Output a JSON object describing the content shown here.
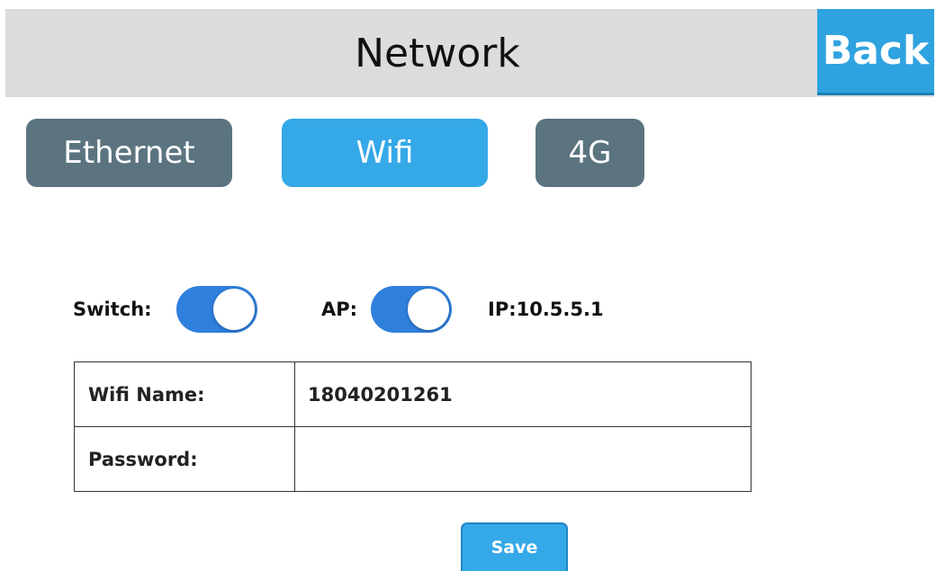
{
  "header": {
    "title": "Network",
    "back_label": "Back"
  },
  "tabs": [
    {
      "label": "Ethernet",
      "active": false
    },
    {
      "label": "Wifi",
      "active": true
    },
    {
      "label": "4G",
      "active": false
    }
  ],
  "toggles": {
    "switch_label": "Switch:",
    "switch_on": true,
    "ap_label": "AP:",
    "ap_on": true,
    "ip_text": "IP:10.5.5.1"
  },
  "form": {
    "wifi_name_label": "Wifi Name:",
    "wifi_name_value": "18040201261",
    "password_label": "Password:",
    "password_value": ""
  },
  "save_label": "Save",
  "colors": {
    "header_bg": "#dcdcdc",
    "accent": "#35a8e8",
    "tab_inactive": "#5b7480",
    "toggle_on": "#2f7fdd"
  }
}
